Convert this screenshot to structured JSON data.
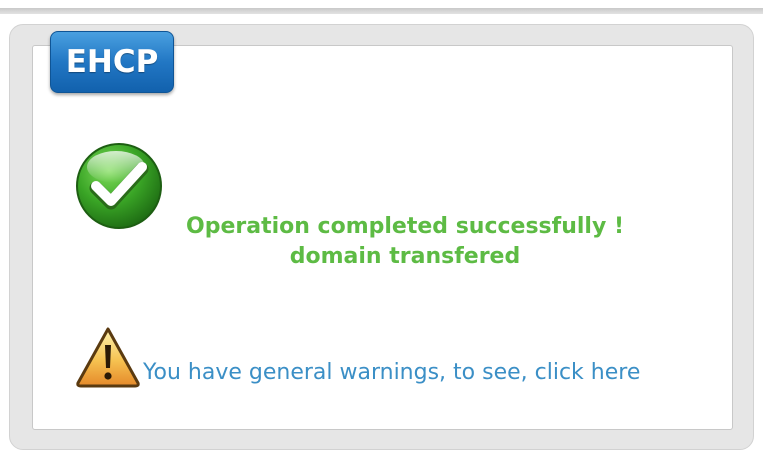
{
  "app": {
    "logo_text": "EHCP",
    "brand_color": "#2277c4"
  },
  "result": {
    "icon": "check-circle-icon",
    "status_color": "#5dbb44",
    "line1": "Operation completed successfully !",
    "line2": "domain transfered"
  },
  "warnings": {
    "icon": "warning-triangle-icon",
    "link_text": "You have general warnings, to see, click here",
    "link_color": "#3b8fc6"
  }
}
